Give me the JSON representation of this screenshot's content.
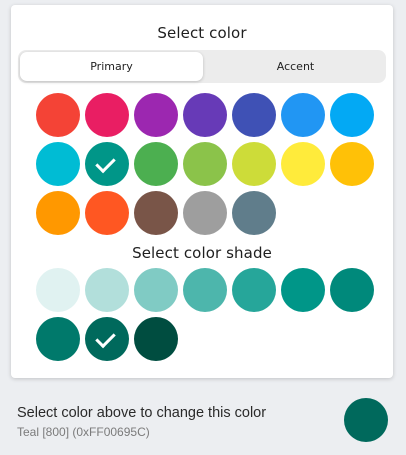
{
  "dialog": {
    "title": "Select color",
    "tabs": [
      {
        "label": "Primary",
        "selected": true
      },
      {
        "label": "Accent",
        "selected": false
      }
    ],
    "shade_title": "Select color shade"
  },
  "colors": [
    {
      "name": "red",
      "hex": "#F44336"
    },
    {
      "name": "pink",
      "hex": "#E91E63"
    },
    {
      "name": "purple",
      "hex": "#9C27B0"
    },
    {
      "name": "deep-purple",
      "hex": "#673AB7"
    },
    {
      "name": "indigo",
      "hex": "#3F51B5"
    },
    {
      "name": "blue",
      "hex": "#2196F3"
    },
    {
      "name": "light-blue",
      "hex": "#03A9F4"
    },
    {
      "name": "cyan",
      "hex": "#00BCD4"
    },
    {
      "name": "teal",
      "hex": "#009688",
      "selected": true
    },
    {
      "name": "green",
      "hex": "#4CAF50"
    },
    {
      "name": "light-green",
      "hex": "#8BC34A"
    },
    {
      "name": "lime",
      "hex": "#CDDC39"
    },
    {
      "name": "yellow",
      "hex": "#FFEB3B"
    },
    {
      "name": "amber",
      "hex": "#FFC107"
    },
    {
      "name": "orange",
      "hex": "#FF9800"
    },
    {
      "name": "deep-orange",
      "hex": "#FF5722"
    },
    {
      "name": "brown",
      "hex": "#795548"
    },
    {
      "name": "grey",
      "hex": "#9E9E9E"
    },
    {
      "name": "blue-grey",
      "hex": "#607D8B"
    }
  ],
  "shades": [
    {
      "name": "teal-50",
      "hex": "#E0F2F1"
    },
    {
      "name": "teal-100",
      "hex": "#B2DFDB"
    },
    {
      "name": "teal-200",
      "hex": "#80CBC4"
    },
    {
      "name": "teal-300",
      "hex": "#4DB6AC"
    },
    {
      "name": "teal-400",
      "hex": "#26A69A"
    },
    {
      "name": "teal-500",
      "hex": "#009688"
    },
    {
      "name": "teal-600",
      "hex": "#00897B"
    },
    {
      "name": "teal-700",
      "hex": "#00796B"
    },
    {
      "name": "teal-800",
      "hex": "#00695C",
      "selected": true
    },
    {
      "name": "teal-900",
      "hex": "#004D40"
    }
  ],
  "footer": {
    "instruction": "Select color above to change this color",
    "current_label": "Teal [800] (0xFF00695C)",
    "current_hex": "#00695C"
  }
}
